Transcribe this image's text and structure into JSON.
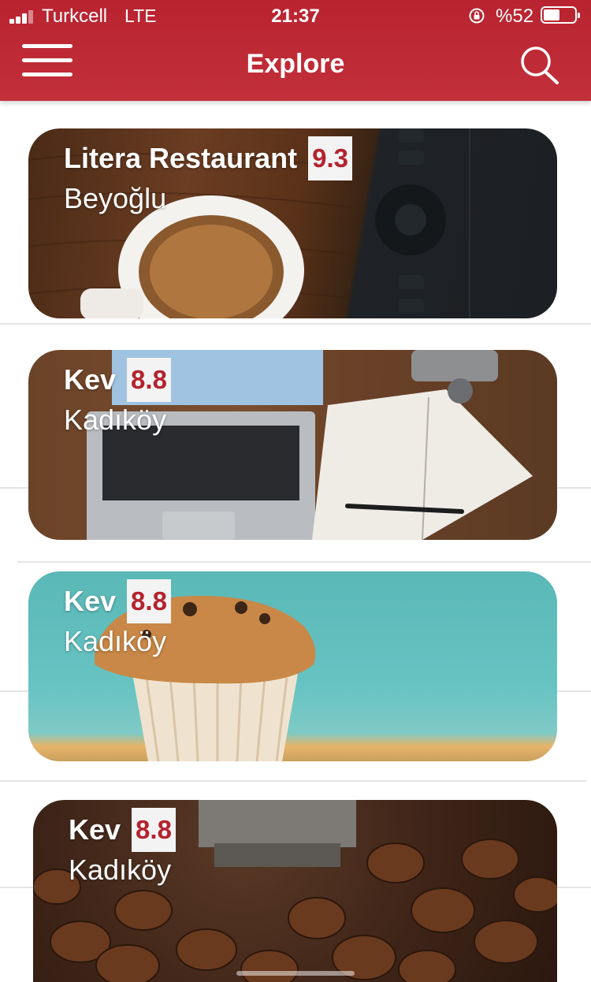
{
  "status_bar": {
    "carrier": "Turkcell",
    "network": "LTE",
    "time": "21:37",
    "battery_percent": "%52",
    "battery_level": 0.52
  },
  "nav": {
    "title": "Explore",
    "menu_icon": "hamburger-menu-icon",
    "search_icon": "search-icon"
  },
  "colors": {
    "header": "#bd2a35",
    "rating_text": "#b3232e",
    "rating_bg": "#f3f3f3"
  },
  "places": [
    {
      "name": "Litera Restaurant",
      "rating": "9.3",
      "location": "Beyoğlu",
      "image": "coffee-cup-and-tablet-photo"
    },
    {
      "name": "Kev",
      "rating": "8.8",
      "location": "Kadıköy",
      "image": "laptop-and-notebook-photo"
    },
    {
      "name": "Kev",
      "rating": "8.8",
      "location": "Kadıköy",
      "image": "muffin-photo"
    },
    {
      "name": "Kev",
      "rating": "8.8",
      "location": "Kadıköy",
      "image": "coffee-beans-photo"
    }
  ]
}
